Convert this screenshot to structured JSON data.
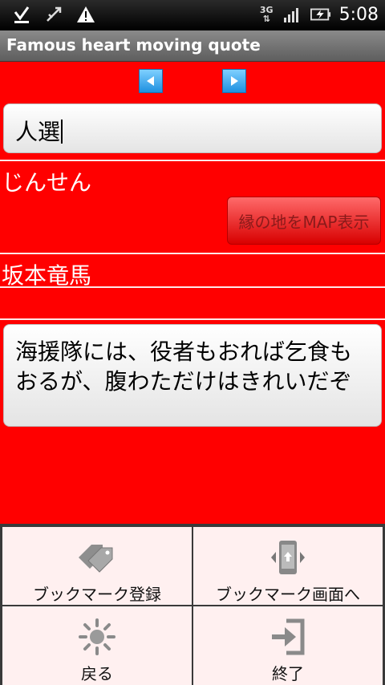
{
  "status_bar": {
    "network": "3G",
    "time": "5:08"
  },
  "title_bar": {
    "title": "Famous heart moving quote"
  },
  "word": {
    "value": "人選"
  },
  "reading": "じんせん",
  "map_button": {
    "label": "縁の地をMAP表示"
  },
  "author": "坂本竜馬",
  "quote": "海援隊には、役者もおれば乞食もおるが、腹わただけはきれいだぞ",
  "menu": {
    "items": [
      {
        "label": "ブックマーク登録",
        "icon": "bookmark-tags-icon"
      },
      {
        "label": "ブックマーク画面へ",
        "icon": "bookmark-screen-icon"
      },
      {
        "label": "戻る",
        "icon": "sun-back-icon"
      },
      {
        "label": "終了",
        "icon": "exit-icon"
      }
    ]
  },
  "colors": {
    "background": "#ff0000",
    "menu_bg": "#fff0f0",
    "arrow": "#2b9be8"
  }
}
